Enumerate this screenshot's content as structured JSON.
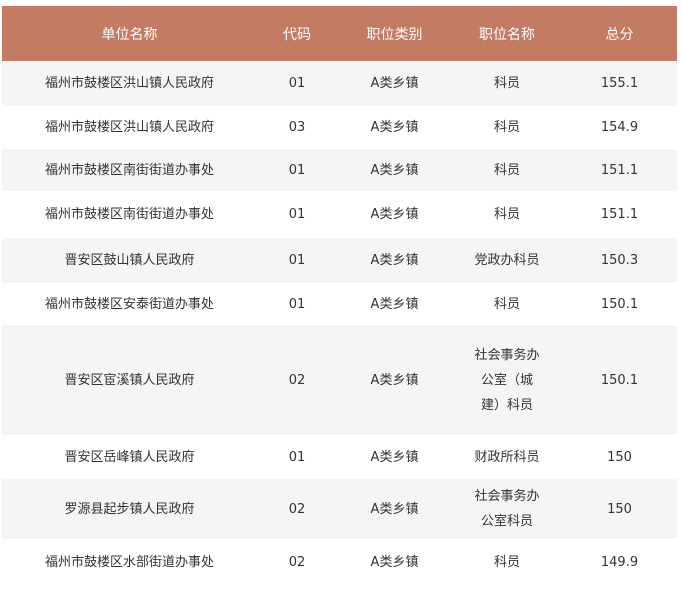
{
  "headers": [
    "单位名称",
    "代码",
    "职位类别",
    "职位名称",
    "总分"
  ],
  "rows": [
    {
      "unit": "福州市鼓楼区洪山镇人民政府",
      "code": "01",
      "category": "A类乡镇",
      "position": "科员",
      "score": "155.1"
    },
    {
      "unit": "福州市鼓楼区洪山镇人民政府",
      "code": "03",
      "category": "A类乡镇",
      "position": "科员",
      "score": "154.9"
    },
    {
      "unit": "福州市鼓楼区南街街道办事处",
      "code": "01",
      "category": "A类乡镇",
      "position": "科员",
      "score": "151.1"
    },
    {
      "unit": "福州市鼓楼区南街街道办事处",
      "code": "01",
      "category": "A类乡镇",
      "position": "科员",
      "score": "151.1"
    },
    {
      "unit": "晋安区鼓山镇人民政府",
      "code": "01",
      "category": "A类乡镇",
      "position": "党政办科员",
      "score": "150.3"
    },
    {
      "unit": "福州市鼓楼区安泰街道办事处",
      "code": "01",
      "category": "A类乡镇",
      "position": "科员",
      "score": "150.1"
    },
    {
      "unit": "晋安区宦溪镇人民政府",
      "code": "02",
      "category": "A类乡镇",
      "position": "社会事务办公室（城建）科员",
      "score": "150.1"
    },
    {
      "unit": "晋安区岳峰镇人民政府",
      "code": "01",
      "category": "A类乡镇",
      "position": "财政所科员",
      "score": "150"
    },
    {
      "unit": "罗源县起步镇人民政府",
      "code": "02",
      "category": "A类乡镇",
      "position": "社会事务办公室科员",
      "score": "150"
    },
    {
      "unit": "福州市鼓楼区水部街道办事处",
      "code": "02",
      "category": "A类乡镇",
      "position": "科员",
      "score": "149.9"
    }
  ]
}
